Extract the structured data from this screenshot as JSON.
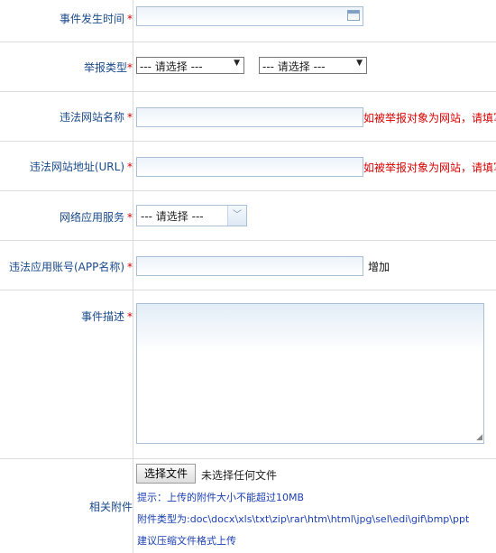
{
  "form": {
    "event_time": {
      "label": "事件发生时间",
      "required": "*",
      "icon": "calendar-icon"
    },
    "report_type": {
      "label": "举报类型",
      "required": "*",
      "select1": "--- 请选择 ---",
      "select2": "--- 请选择 ---"
    },
    "site_name": {
      "label": "违法网站名称",
      "required": "*",
      "hint": "如被举报对象为网站，请填写"
    },
    "site_url": {
      "label": "违法网站地址(URL)",
      "required": "*",
      "hint": "如被举报对象为网站，请填写"
    },
    "app_service": {
      "label": "网络应用服务",
      "required": "*",
      "select": "--- 请选择 ---"
    },
    "app_account": {
      "label": "违法应用账号(APP名称)",
      "required": "*",
      "add_label": "增加"
    },
    "description": {
      "label": "事件描述",
      "required": "*"
    },
    "attachment": {
      "label": "相关附件",
      "choose_button": "选择文件",
      "no_file": "未选择任何文件",
      "tip_size": "提示：上传的附件大小不能超过10MB",
      "tip_types": "附件类型为:doc\\docx\\xls\\txt\\zip\\rar\\htm\\html\\jpg\\sel\\edi\\gif\\bmp\\ppt",
      "tip_compress": "建议压缩文件格式上传"
    }
  }
}
